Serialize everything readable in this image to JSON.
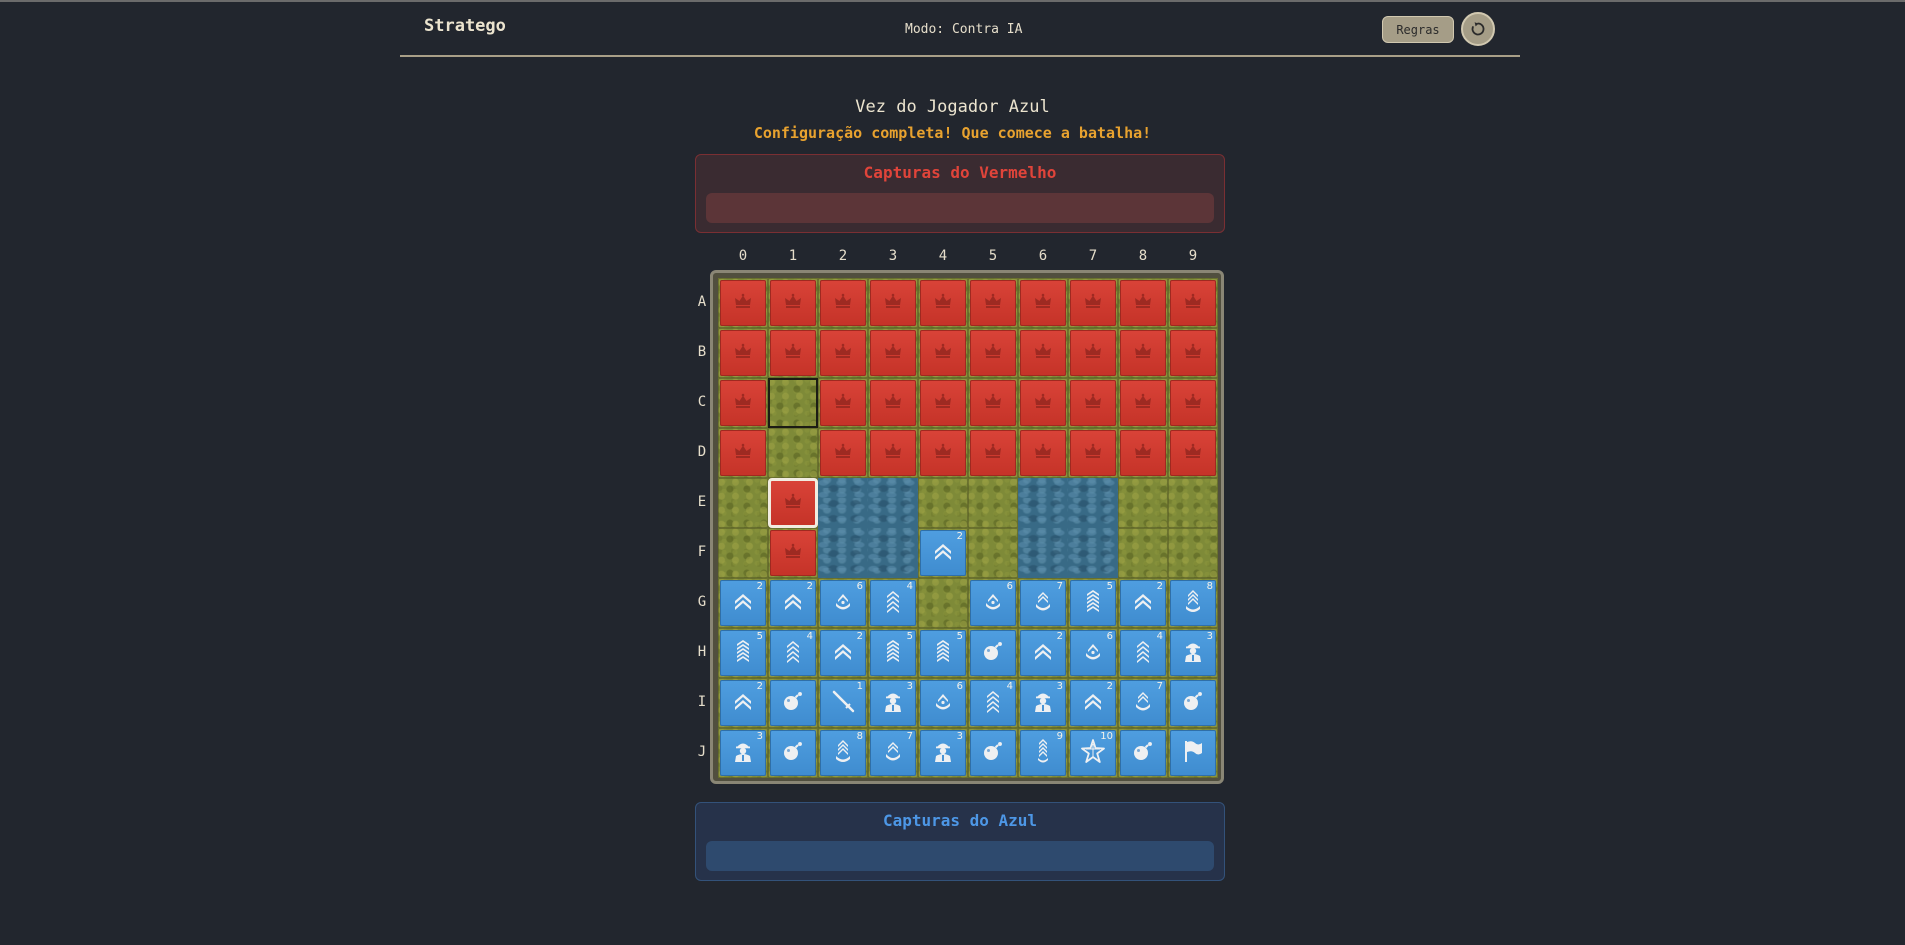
{
  "header": {
    "brand": "Stratego",
    "mode": "Modo: Contra IA",
    "rules_label": "Regras"
  },
  "status": {
    "turn": "Vez do Jogador Azul",
    "message": "Configuração completa! Que comece a batalha!"
  },
  "captures": {
    "red_title": "Capturas do Vermelho",
    "blue_title": "Capturas do Azul"
  },
  "colors": {
    "red_piece": "#d23d32",
    "blue_piece": "#4896d9",
    "grass": "#7e8a38",
    "water": "#386a86",
    "message": "#e8a22f"
  },
  "board": {
    "columns": [
      "0",
      "1",
      "2",
      "3",
      "4",
      "5",
      "6",
      "7",
      "8",
      "9"
    ],
    "rows": [
      "A",
      "B",
      "C",
      "D",
      "E",
      "F",
      "G",
      "H",
      "I",
      "J"
    ],
    "lakes": [
      "E2",
      "E3",
      "F2",
      "F3",
      "E6",
      "E7",
      "F6",
      "F7"
    ],
    "highlighted_empty": "C1",
    "selected": "E1",
    "red_pieces": [
      "A0",
      "A1",
      "A2",
      "A3",
      "A4",
      "A5",
      "A6",
      "A7",
      "A8",
      "A9",
      "B0",
      "B1",
      "B2",
      "B3",
      "B4",
      "B5",
      "B6",
      "B7",
      "B8",
      "B9",
      "C0",
      "C2",
      "C3",
      "C4",
      "C5",
      "C6",
      "C7",
      "C8",
      "C9",
      "D0",
      "D2",
      "D3",
      "D4",
      "D5",
      "D6",
      "D7",
      "D8",
      "D9",
      "E1",
      "F1"
    ],
    "red_icon": "crown-icon",
    "blue_pieces": [
      {
        "cell": "F4",
        "rank": "2",
        "icon": "scout-chevrons-icon"
      },
      {
        "cell": "G0",
        "rank": "2",
        "icon": "scout-chevrons-icon"
      },
      {
        "cell": "G1",
        "rank": "2",
        "icon": "scout-chevrons-icon"
      },
      {
        "cell": "G2",
        "rank": "6",
        "icon": "captain-icon"
      },
      {
        "cell": "G3",
        "rank": "4",
        "icon": "sergeant-chevrons-icon"
      },
      {
        "cell": "G5",
        "rank": "6",
        "icon": "captain-icon"
      },
      {
        "cell": "G6",
        "rank": "7",
        "icon": "major-icon"
      },
      {
        "cell": "G7",
        "rank": "5",
        "icon": "lieutenant-chevrons-icon"
      },
      {
        "cell": "G8",
        "rank": "2",
        "icon": "scout-chevrons-icon"
      },
      {
        "cell": "G9",
        "rank": "8",
        "icon": "colonel-icon"
      },
      {
        "cell": "H0",
        "rank": "5",
        "icon": "lieutenant-chevrons-icon"
      },
      {
        "cell": "H1",
        "rank": "4",
        "icon": "sergeant-chevrons-icon"
      },
      {
        "cell": "H2",
        "rank": "2",
        "icon": "scout-chevrons-icon"
      },
      {
        "cell": "H3",
        "rank": "5",
        "icon": "lieutenant-chevrons-icon"
      },
      {
        "cell": "H4",
        "rank": "5",
        "icon": "lieutenant-chevrons-icon"
      },
      {
        "cell": "H5",
        "rank": "",
        "icon": "bomb-icon"
      },
      {
        "cell": "H6",
        "rank": "2",
        "icon": "scout-chevrons-icon"
      },
      {
        "cell": "H7",
        "rank": "6",
        "icon": "captain-icon"
      },
      {
        "cell": "H8",
        "rank": "4",
        "icon": "sergeant-chevrons-icon"
      },
      {
        "cell": "H9",
        "rank": "3",
        "icon": "miner-icon"
      },
      {
        "cell": "I0",
        "rank": "2",
        "icon": "scout-chevrons-icon"
      },
      {
        "cell": "I1",
        "rank": "",
        "icon": "bomb-icon"
      },
      {
        "cell": "I2",
        "rank": "1",
        "icon": "spy-dagger-icon"
      },
      {
        "cell": "I3",
        "rank": "3",
        "icon": "miner-icon"
      },
      {
        "cell": "I4",
        "rank": "6",
        "icon": "captain-icon"
      },
      {
        "cell": "I5",
        "rank": "4",
        "icon": "sergeant-chevrons-icon"
      },
      {
        "cell": "I6",
        "rank": "3",
        "icon": "miner-icon"
      },
      {
        "cell": "I7",
        "rank": "2",
        "icon": "scout-chevrons-icon"
      },
      {
        "cell": "I8",
        "rank": "7",
        "icon": "major-icon"
      },
      {
        "cell": "I9",
        "rank": "",
        "icon": "bomb-icon"
      },
      {
        "cell": "J0",
        "rank": "3",
        "icon": "miner-icon"
      },
      {
        "cell": "J1",
        "rank": "",
        "icon": "bomb-icon"
      },
      {
        "cell": "J2",
        "rank": "8",
        "icon": "colonel-icon"
      },
      {
        "cell": "J3",
        "rank": "7",
        "icon": "major-icon"
      },
      {
        "cell": "J4",
        "rank": "3",
        "icon": "miner-icon"
      },
      {
        "cell": "J5",
        "rank": "",
        "icon": "bomb-icon"
      },
      {
        "cell": "J6",
        "rank": "9",
        "icon": "general-icon"
      },
      {
        "cell": "J7",
        "rank": "10",
        "icon": "marshal-star-icon"
      },
      {
        "cell": "J8",
        "rank": "",
        "icon": "bomb-icon"
      },
      {
        "cell": "J9",
        "rank": "",
        "icon": "flag-icon"
      }
    ]
  }
}
